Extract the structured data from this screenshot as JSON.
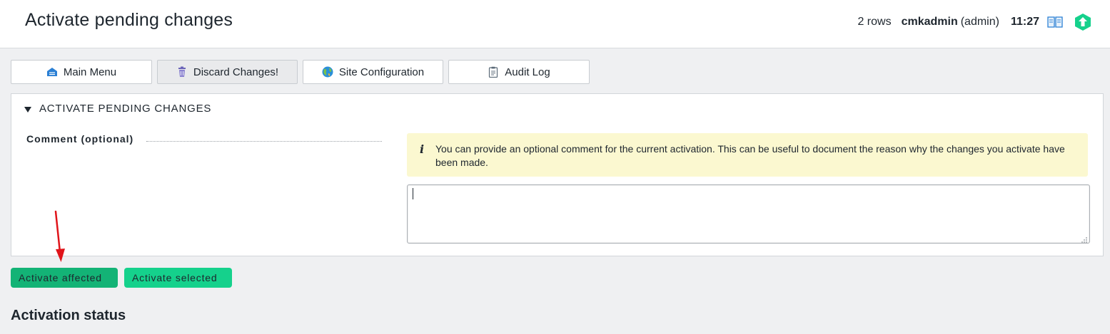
{
  "header": {
    "title": "Activate pending changes",
    "rows": "2 rows",
    "user": "cmkadmin",
    "role": "(admin)",
    "time": "11:27",
    "icons": [
      "book-icon",
      "checkmk-logo-icon"
    ]
  },
  "toolbar": {
    "buttons": [
      {
        "label": "Main Menu",
        "icon": "main-menu-icon"
      },
      {
        "label": "Discard Changes!",
        "icon": "trash-icon"
      },
      {
        "label": "Site Configuration",
        "icon": "globe-icon"
      },
      {
        "label": "Audit Log",
        "icon": "clipboard-icon"
      }
    ]
  },
  "panel": {
    "heading": "ACTIVATE PENDING CHANGES",
    "comment_label": "Comment (optional)",
    "info_text": "You can provide an optional comment for the current activation. This can be useful to document the reason why the changes you activate have been made.",
    "comment_value": ""
  },
  "actions": {
    "affected_label": "Activate affected",
    "selected_label": "Activate selected"
  },
  "section": {
    "title": "Activation status"
  },
  "colors": {
    "activate_affected": "#13b376",
    "activate_selected": "#15d18c",
    "info_background": "#fbf8d0",
    "annotation_arrow": "#e0141a",
    "page_background": "#eff0f2"
  }
}
